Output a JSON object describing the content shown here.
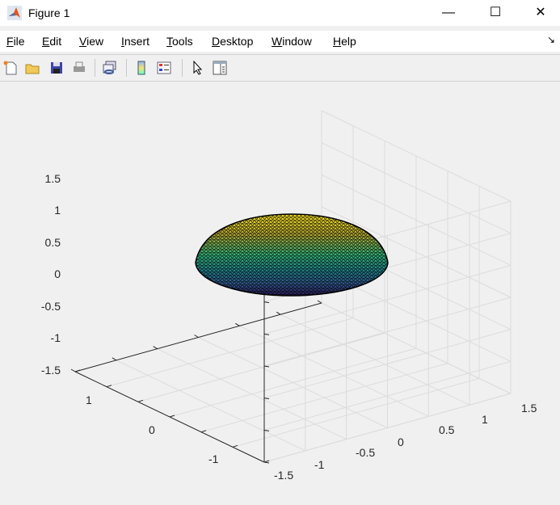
{
  "window": {
    "title": "Figure 1",
    "minimize": "—",
    "maximize": "☐",
    "close": "✕"
  },
  "menu": [
    "File",
    "Edit",
    "View",
    "Insert",
    "Tools",
    "Desktop",
    "Window",
    "Help"
  ],
  "dock_icon": "↘",
  "toolbar": [
    "new-figure-icon",
    "open-icon",
    "save-icon",
    "print-icon",
    "link-plot-icon",
    "colorbar-icon",
    "legend-icon",
    "pointer-icon",
    "property-inspector-icon"
  ],
  "axes": {
    "z_ticks": [
      "1.5",
      "1",
      "0.5",
      "0",
      "-0.5",
      "-1",
      "-1.5"
    ],
    "y_ticks": [
      "1",
      "0",
      "-1"
    ],
    "x_ticks": [
      "-1.5",
      "-1",
      "-0.5",
      "0",
      "0.5",
      "1",
      "1.5"
    ],
    "limits": [
      -1.5,
      1.5
    ]
  },
  "surface": {
    "type": "sphere cap",
    "colormap": "viridis"
  }
}
